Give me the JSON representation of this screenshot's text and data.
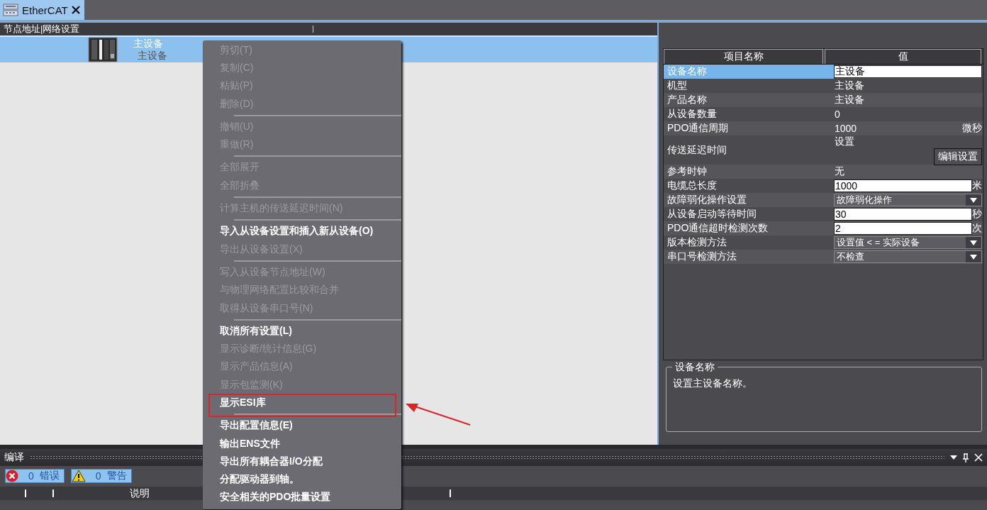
{
  "tab": {
    "title": "EtherCAT",
    "selected": true
  },
  "network": {
    "header": "节点地址|网络设置",
    "node": {
      "name": "主设备",
      "model": "主设备",
      "selected": true
    }
  },
  "properties": {
    "columns": [
      "项目名称",
      "值"
    ],
    "rows": [
      {
        "name": "设备名称",
        "kind": "input",
        "value": "主设备",
        "selected": true
      },
      {
        "name": "机型",
        "kind": "text",
        "value": "主设备",
        "selected": false
      },
      {
        "name": "产品名称",
        "kind": "text",
        "value": "主设备",
        "selected": false
      },
      {
        "name": "从设备数量",
        "kind": "text",
        "value": "0",
        "selected": false
      },
      {
        "name": "PDO通信周期",
        "kind": "text",
        "value": "1000",
        "unit": "微秒",
        "selected": false
      },
      {
        "name": "传送延迟时间",
        "kind": "button",
        "value": "设置",
        "button": "编辑设置",
        "selected": false
      },
      {
        "name": "参考时钟",
        "kind": "text",
        "value": "无",
        "selected": false
      },
      {
        "name": "电缆总长度",
        "kind": "input",
        "value": "1000",
        "unit": "米",
        "selected": false
      },
      {
        "name": "故障弱化操作设置",
        "kind": "select",
        "value": "故障弱化操作",
        "selected": false
      },
      {
        "name": "从设备启动等待时间",
        "kind": "input",
        "value": "30",
        "unit": "秒",
        "selected": false
      },
      {
        "name": "PDO通信超时检测次数",
        "kind": "input",
        "value": "2",
        "unit": "次",
        "selected": false
      },
      {
        "name": "版本检测方法",
        "kind": "select",
        "value": "设置值 < = 实际设备",
        "selected": false
      },
      {
        "name": "串口号检测方法",
        "kind": "select",
        "value": "不检查",
        "selected": false
      }
    ]
  },
  "description": {
    "title": "设备名称",
    "text": "设置主设备名称。"
  },
  "build": {
    "title": "编译",
    "errors": {
      "count": "0",
      "label": "错误"
    },
    "warnings": {
      "count": "0",
      "label": "警告"
    },
    "column": "说明"
  },
  "context_menu": {
    "items": [
      {
        "kind": "item",
        "label": "剪切(T)",
        "disabled": true,
        "marked": false
      },
      {
        "kind": "item",
        "label": "复制(C)",
        "disabled": true,
        "marked": false
      },
      {
        "kind": "item",
        "label": "粘贴(P)",
        "disabled": true,
        "marked": false
      },
      {
        "kind": "item",
        "label": "删除(D)",
        "disabled": true,
        "marked": false
      },
      {
        "kind": "separator"
      },
      {
        "kind": "item",
        "label": "撤销(U)",
        "disabled": true,
        "marked": false
      },
      {
        "kind": "item",
        "label": "重做(R)",
        "disabled": true,
        "marked": false
      },
      {
        "kind": "separator"
      },
      {
        "kind": "item",
        "label": "全部展开",
        "disabled": true,
        "marked": false
      },
      {
        "kind": "item",
        "label": "全部折叠",
        "disabled": true,
        "marked": false
      },
      {
        "kind": "separator"
      },
      {
        "kind": "item",
        "label": "计算主机的传送延迟时间(N)",
        "disabled": true,
        "marked": false
      },
      {
        "kind": "separator"
      },
      {
        "kind": "item",
        "label": "导入从设备设置和插入新从设备(O)",
        "disabled": false,
        "marked": false
      },
      {
        "kind": "item",
        "label": "导出从设备设置(X)",
        "disabled": true,
        "marked": false
      },
      {
        "kind": "separator"
      },
      {
        "kind": "item",
        "label": "写入从设备节点地址(W)",
        "disabled": true,
        "marked": false
      },
      {
        "kind": "item",
        "label": "与物理网络配置比较和合并",
        "disabled": true,
        "marked": false
      },
      {
        "kind": "item",
        "label": "取得从设备串口号(N)",
        "disabled": true,
        "marked": false
      },
      {
        "kind": "separator"
      },
      {
        "kind": "item",
        "label": "取消所有设置(L)",
        "disabled": false,
        "marked": false
      },
      {
        "kind": "item",
        "label": "显示诊断/统计信息(G)",
        "disabled": true,
        "marked": false
      },
      {
        "kind": "item",
        "label": "显示产品信息(A)",
        "disabled": true,
        "marked": false
      },
      {
        "kind": "item",
        "label": "显示包监测(K)",
        "disabled": true,
        "marked": false
      },
      {
        "kind": "item",
        "label": "显示ESI库",
        "disabled": false,
        "marked": true
      },
      {
        "kind": "separator"
      },
      {
        "kind": "item",
        "label": "导出配置信息(E)",
        "disabled": false,
        "marked": false
      },
      {
        "kind": "item",
        "label": "输出ENS文件",
        "disabled": false,
        "marked": false
      },
      {
        "kind": "item",
        "label": "导出所有耦合器I/O分配",
        "disabled": false,
        "marked": false
      },
      {
        "kind": "item",
        "label": "分配驱动器到轴。",
        "disabled": false,
        "marked": false
      },
      {
        "kind": "item",
        "label": "安全相关的PDO批量设置",
        "disabled": false,
        "marked": false
      }
    ]
  }
}
